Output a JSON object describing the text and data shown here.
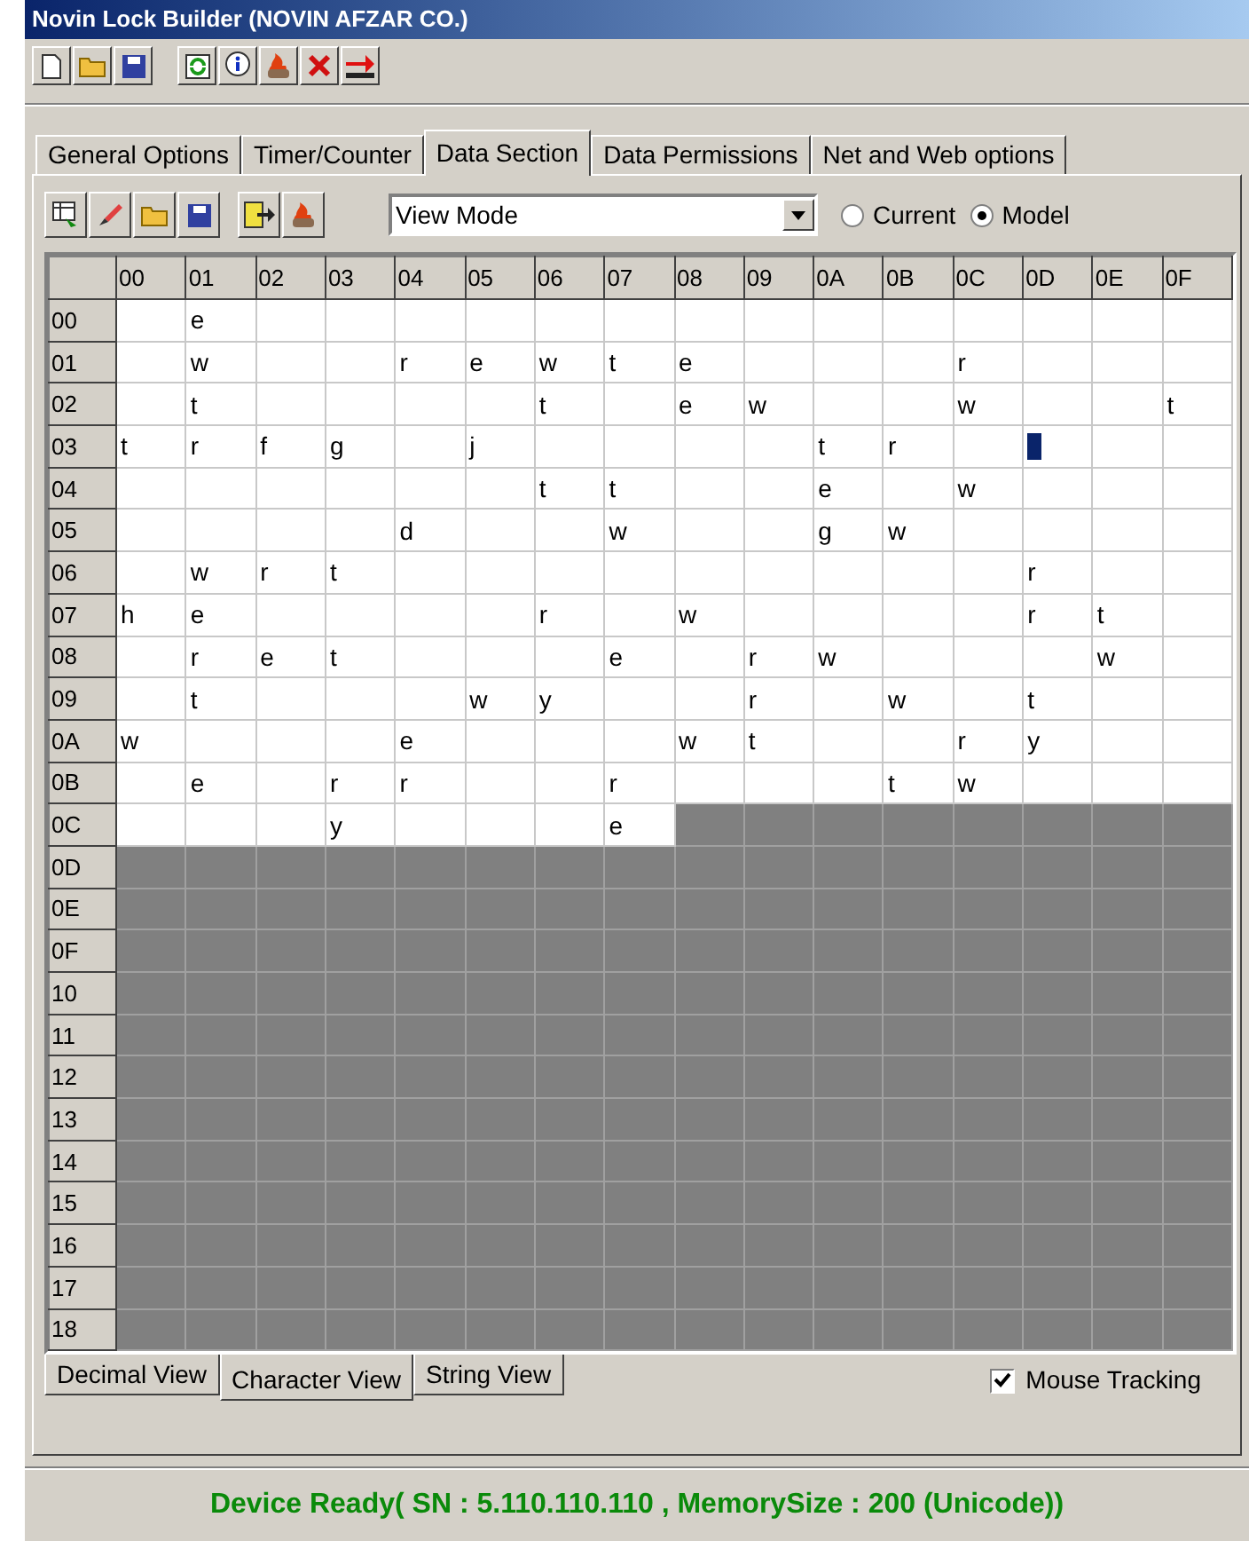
{
  "window": {
    "title": "Novin Lock Builder (NOVIN AFZAR CO.)"
  },
  "tabs": [
    {
      "label": "General Options",
      "selected": false
    },
    {
      "label": "Timer/Counter",
      "selected": false
    },
    {
      "label": "Data Section",
      "selected": true
    },
    {
      "label": "Data Permissions",
      "selected": false
    },
    {
      "label": "Net and Web options",
      "selected": false
    }
  ],
  "view_mode": {
    "value": "View Mode"
  },
  "source_options": [
    {
      "label": "Current",
      "selected": false
    },
    {
      "label": "Model",
      "selected": true
    }
  ],
  "grid": {
    "columns": [
      "00",
      "01",
      "02",
      "03",
      "04",
      "05",
      "06",
      "07",
      "08",
      "09",
      "0A",
      "0B",
      "0C",
      "0D",
      "0E",
      "0F"
    ],
    "rows": [
      {
        "label": "00",
        "cells": [
          {},
          {
            "text": "e"
          },
          {},
          {},
          {},
          {},
          {},
          {},
          {},
          {},
          {},
          {},
          {},
          {},
          {},
          {}
        ]
      },
      {
        "label": "01",
        "cells": [
          {},
          {
            "text": "w"
          },
          {},
          {},
          {
            "text": "r"
          },
          {
            "text": "e"
          },
          {
            "text": "w"
          },
          {
            "text": "t"
          },
          {
            "text": "e"
          },
          {},
          {},
          {},
          {
            "text": "r"
          },
          {},
          {},
          {}
        ]
      },
      {
        "label": "02",
        "cells": [
          {},
          {
            "text": "t"
          },
          {},
          {},
          {},
          {},
          {
            "text": "t"
          },
          {},
          {
            "text": "e"
          },
          {
            "text": "w"
          },
          {},
          {},
          {
            "text": "w"
          },
          {},
          {},
          {
            "text": "t"
          }
        ]
      },
      {
        "label": "03",
        "cells": [
          {
            "text": "t"
          },
          {
            "text": "r"
          },
          {
            "text": "f"
          },
          {
            "text": "g"
          },
          {},
          {
            "text": "j"
          },
          {},
          {},
          {},
          {},
          {
            "text": "t"
          },
          {
            "text": "r"
          },
          {},
          {
            "cursor": true
          },
          {},
          {}
        ]
      },
      {
        "label": "04",
        "cells": [
          {},
          {},
          {},
          {},
          {},
          {},
          {
            "text": "t"
          },
          {
            "text": "t"
          },
          {},
          {},
          {
            "text": "e"
          },
          {},
          {
            "text": "w"
          },
          {},
          {},
          {}
        ]
      },
      {
        "label": "05",
        "cells": [
          {},
          {},
          {},
          {},
          {
            "text": "d"
          },
          {},
          {},
          {
            "text": "w"
          },
          {},
          {},
          {
            "text": "g"
          },
          {
            "text": "w"
          },
          {},
          {},
          {},
          {}
        ]
      },
      {
        "label": "06",
        "cells": [
          {},
          {
            "text": "w"
          },
          {
            "text": "r"
          },
          {
            "text": "t"
          },
          {},
          {},
          {},
          {},
          {},
          {},
          {},
          {},
          {},
          {
            "text": "r"
          },
          {},
          {}
        ]
      },
      {
        "label": "07",
        "cells": [
          {
            "text": "h"
          },
          {
            "text": "e"
          },
          {},
          {},
          {},
          {},
          {
            "text": "r"
          },
          {},
          {
            "text": "w"
          },
          {},
          {},
          {},
          {},
          {
            "text": "r"
          },
          {
            "text": "t"
          },
          {}
        ]
      },
      {
        "label": "08",
        "cells": [
          {},
          {
            "text": "r"
          },
          {
            "text": "e"
          },
          {
            "text": "t"
          },
          {},
          {},
          {},
          {
            "text": "e"
          },
          {},
          {
            "text": "r"
          },
          {
            "text": "w"
          },
          {},
          {},
          {},
          {
            "text": "w"
          },
          {}
        ]
      },
      {
        "label": "09",
        "cells": [
          {},
          {
            "text": "t"
          },
          {},
          {},
          {},
          {
            "text": "w"
          },
          {
            "text": "y"
          },
          {},
          {},
          {
            "text": "r"
          },
          {},
          {
            "text": "w"
          },
          {},
          {
            "text": "t"
          },
          {},
          {}
        ]
      },
      {
        "label": "0A",
        "cells": [
          {
            "text": "w"
          },
          {},
          {},
          {},
          {
            "text": "e"
          },
          {},
          {},
          {},
          {
            "text": "w"
          },
          {
            "text": "t"
          },
          {},
          {},
          {
            "text": "r"
          },
          {
            "text": "y"
          },
          {},
          {}
        ]
      },
      {
        "label": "0B",
        "cells": [
          {},
          {
            "text": "e"
          },
          {},
          {
            "text": "r"
          },
          {
            "text": "r"
          },
          {},
          {},
          {
            "text": "r"
          },
          {},
          {},
          {},
          {
            "text": "t"
          },
          {
            "text": "w"
          },
          {},
          {},
          {}
        ]
      },
      {
        "label": "0C",
        "cells": [
          {},
          {},
          {},
          {
            "text": "y"
          },
          {},
          {},
          {},
          {
            "text": "e"
          },
          {
            "unused": true
          },
          {
            "unused": true
          },
          {
            "unused": true
          },
          {
            "unused": true
          },
          {
            "unused": true
          },
          {
            "unused": true
          },
          {
            "unused": true
          },
          {
            "unused": true
          }
        ]
      },
      {
        "label": "0D",
        "unused": true
      },
      {
        "label": "0E",
        "unused": true
      },
      {
        "label": "0F",
        "unused": true
      },
      {
        "label": "10",
        "unused": true
      },
      {
        "label": "11",
        "unused": true
      },
      {
        "label": "12",
        "unused": true
      },
      {
        "label": "13",
        "unused": true
      },
      {
        "label": "14",
        "unused": true
      },
      {
        "label": "15",
        "unused": true
      },
      {
        "label": "16",
        "unused": true
      },
      {
        "label": "17",
        "unused": true
      },
      {
        "label": "18",
        "unused": true
      }
    ]
  },
  "view_tabs": [
    {
      "label": "Decimal View",
      "selected": false
    },
    {
      "label": "Character View",
      "selected": true
    },
    {
      "label": "String View",
      "selected": false
    }
  ],
  "mouse_tracking": {
    "label": "Mouse Tracking",
    "checked": true
  },
  "status_bar": {
    "text": "Device Ready( SN : 5.110.110.110 , MemorySize : 200 (Unicode))"
  }
}
